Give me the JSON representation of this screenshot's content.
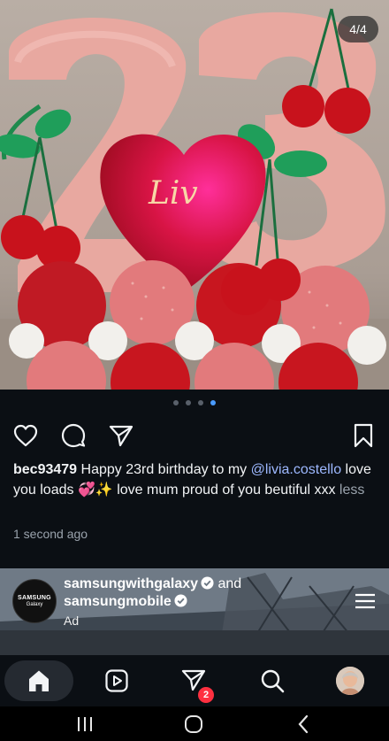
{
  "post": {
    "carousel_counter": "4/4",
    "balloon_text": "Liv",
    "carousel_pages": 4,
    "carousel_active": 4
  },
  "caption": {
    "username": "bec93479",
    "text_1": " Happy 23rd birthday to my ",
    "mention": "@livia.costello",
    "text_2": " love you loads 💞✨ love mum proud of you beutiful xxx ",
    "less": "less",
    "timestamp": "1 second ago"
  },
  "ad": {
    "account_1": "samsungwithgalaxy",
    "and": " and",
    "account_2": "samsungmobile",
    "label": "Ad",
    "avatar_line_1": "SAMSUNG",
    "avatar_line_2": "Galaxy"
  },
  "nav": {
    "messages_badge": "2"
  },
  "icons": [
    "heart-icon",
    "comment-icon",
    "share-icon",
    "bookmark-icon",
    "home-icon",
    "reels-icon",
    "messages-icon",
    "search-icon",
    "profile-avatar",
    "recents-icon",
    "home-circle-icon",
    "back-icon",
    "verified-icon",
    "menu-icon"
  ],
  "colors": {
    "background": "#0b0f14",
    "accent": "#4a9bff",
    "badge": "#ff3040",
    "mention": "#9db8ff"
  }
}
